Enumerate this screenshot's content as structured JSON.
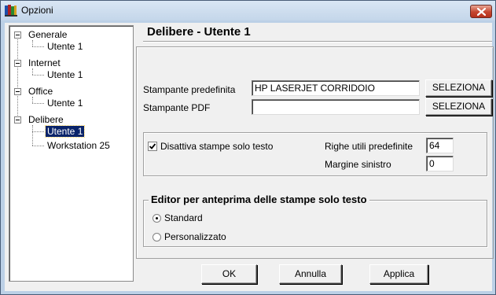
{
  "window": {
    "title": "Opzioni",
    "icon": "books-icon",
    "close_icon": "close-icon"
  },
  "tree": {
    "nodes": [
      {
        "label": "Generale",
        "child": "Utente  1"
      },
      {
        "label": "Internet",
        "child": "Utente  1"
      },
      {
        "label": "Office",
        "child": "Utente  1"
      },
      {
        "label": "Delibere",
        "children": [
          "Utente  1",
          "Workstation 25"
        ],
        "selected_child": "Utente  1"
      }
    ]
  },
  "main": {
    "heading": "Delibere - Utente  1",
    "printer_default_label": "Stampante predefinita",
    "printer_default_value": "HP LASERJET CORRIDOIO",
    "printer_pdf_label": "Stampante PDF",
    "printer_pdf_value": "",
    "select_label": "SELEZIONA",
    "disable_text_print_label": "Disattiva stampe solo testo",
    "disable_text_print_checked": true,
    "lines_label": "Righe utili predefinite",
    "lines_value": "64",
    "margin_label": "Margine sinistro",
    "margin_value": "0",
    "editor_group_title": "Editor per anteprima delle stampe solo testo",
    "editor_options": [
      "Standard",
      "Personalizzato"
    ],
    "editor_selected": "Standard"
  },
  "buttons": {
    "ok": "OK",
    "cancel": "Annulla",
    "apply": "Applica"
  }
}
